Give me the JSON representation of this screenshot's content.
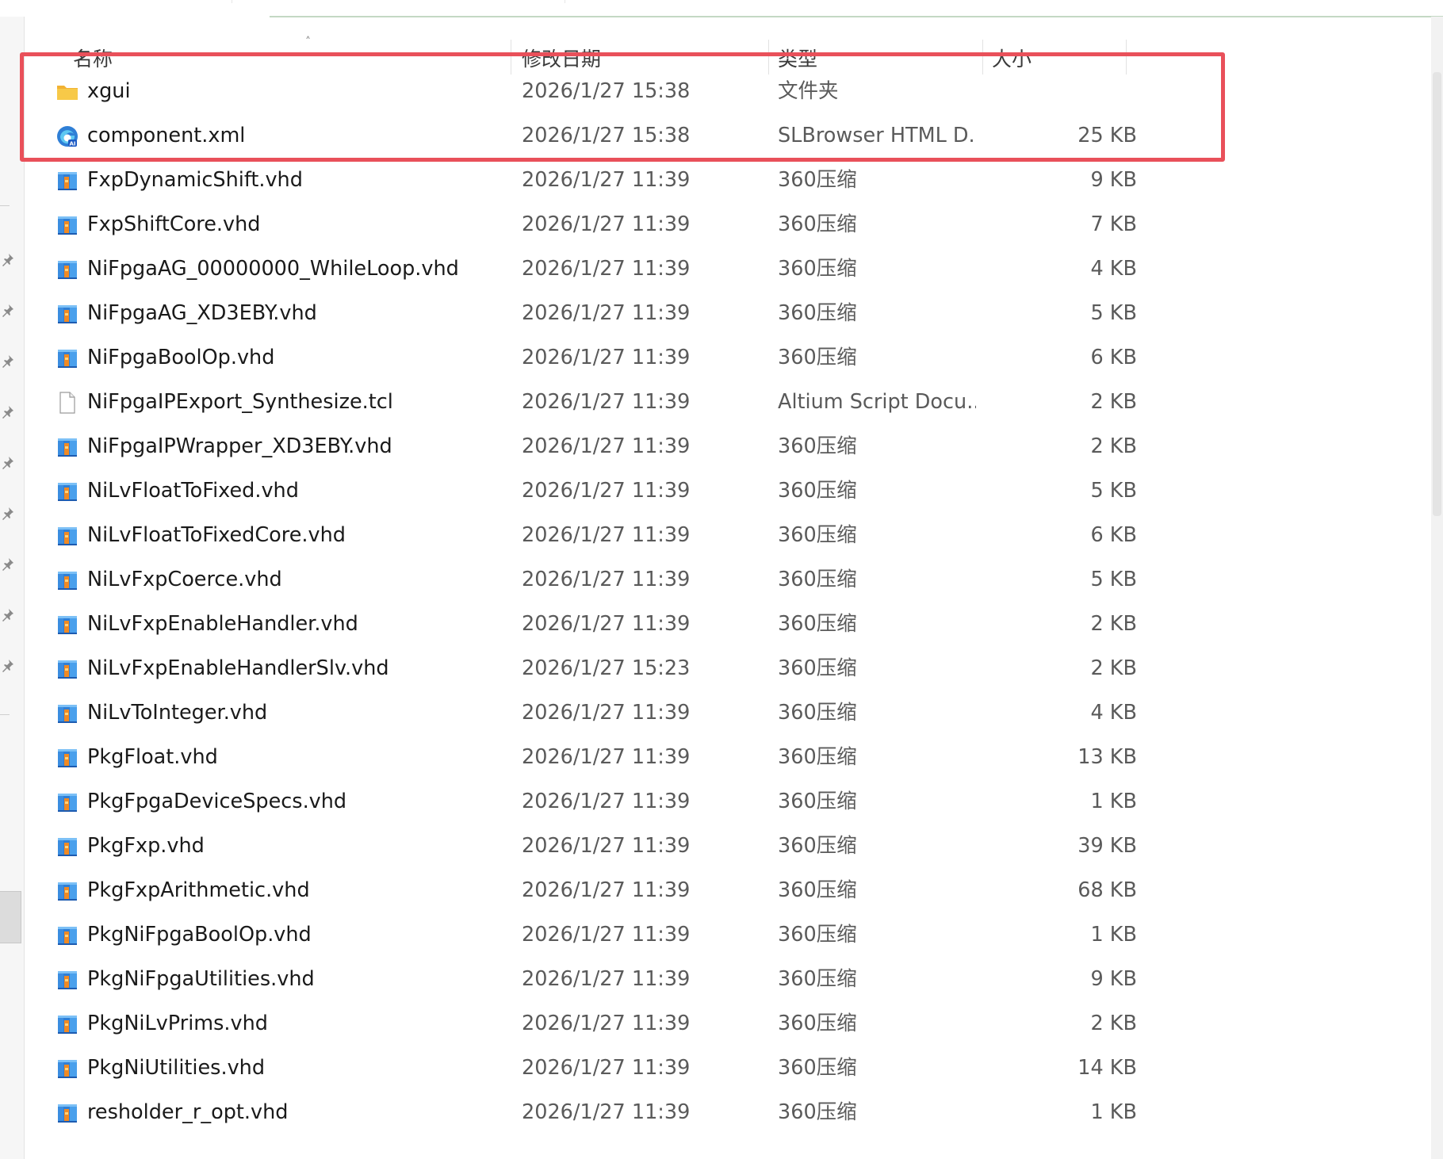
{
  "columns": {
    "name": "名称",
    "modified": "修改日期",
    "type": "类型",
    "size": "大小"
  },
  "files": [
    {
      "name": "xgui",
      "modified": "2026/1/27 15:38",
      "type": "文件夹",
      "size": "",
      "icon": "folder-icon"
    },
    {
      "name": "component.xml",
      "modified": "2026/1/27 15:38",
      "type": "SLBrowser HTML D...",
      "size": "25 KB",
      "icon": "browser-document-icon"
    },
    {
      "name": "FxpDynamicShift.vhd",
      "modified": "2026/1/27 11:39",
      "type": "360压缩",
      "size": "9 KB",
      "icon": "archive-icon"
    },
    {
      "name": "FxpShiftCore.vhd",
      "modified": "2026/1/27 11:39",
      "type": "360压缩",
      "size": "7 KB",
      "icon": "archive-icon"
    },
    {
      "name": "NiFpgaAG_00000000_WhileLoop.vhd",
      "modified": "2026/1/27 11:39",
      "type": "360压缩",
      "size": "4 KB",
      "icon": "archive-icon"
    },
    {
      "name": "NiFpgaAG_XD3EBY.vhd",
      "modified": "2026/1/27 11:39",
      "type": "360压缩",
      "size": "5 KB",
      "icon": "archive-icon"
    },
    {
      "name": "NiFpgaBoolOp.vhd",
      "modified": "2026/1/27 11:39",
      "type": "360压缩",
      "size": "6 KB",
      "icon": "archive-icon"
    },
    {
      "name": "NiFpgaIPExport_Synthesize.tcl",
      "modified": "2026/1/27 11:39",
      "type": "Altium Script Docu...",
      "size": "2 KB",
      "icon": "blank-file-icon"
    },
    {
      "name": "NiFpgaIPWrapper_XD3EBY.vhd",
      "modified": "2026/1/27 11:39",
      "type": "360压缩",
      "size": "2 KB",
      "icon": "archive-icon"
    },
    {
      "name": "NiLvFloatToFixed.vhd",
      "modified": "2026/1/27 11:39",
      "type": "360压缩",
      "size": "5 KB",
      "icon": "archive-icon"
    },
    {
      "name": "NiLvFloatToFixedCore.vhd",
      "modified": "2026/1/27 11:39",
      "type": "360压缩",
      "size": "6 KB",
      "icon": "archive-icon"
    },
    {
      "name": "NiLvFxpCoerce.vhd",
      "modified": "2026/1/27 11:39",
      "type": "360压缩",
      "size": "5 KB",
      "icon": "archive-icon"
    },
    {
      "name": "NiLvFxpEnableHandler.vhd",
      "modified": "2026/1/27 11:39",
      "type": "360压缩",
      "size": "2 KB",
      "icon": "archive-icon"
    },
    {
      "name": "NiLvFxpEnableHandlerSlv.vhd",
      "modified": "2026/1/27 15:23",
      "type": "360压缩",
      "size": "2 KB",
      "icon": "archive-icon"
    },
    {
      "name": "NiLvToInteger.vhd",
      "modified": "2026/1/27 11:39",
      "type": "360压缩",
      "size": "4 KB",
      "icon": "archive-icon"
    },
    {
      "name": "PkgFloat.vhd",
      "modified": "2026/1/27 11:39",
      "type": "360压缩",
      "size": "13 KB",
      "icon": "archive-icon"
    },
    {
      "name": "PkgFpgaDeviceSpecs.vhd",
      "modified": "2026/1/27 11:39",
      "type": "360压缩",
      "size": "1 KB",
      "icon": "archive-icon"
    },
    {
      "name": "PkgFxp.vhd",
      "modified": "2026/1/27 11:39",
      "type": "360压缩",
      "size": "39 KB",
      "icon": "archive-icon"
    },
    {
      "name": "PkgFxpArithmetic.vhd",
      "modified": "2026/1/27 11:39",
      "type": "360压缩",
      "size": "68 KB",
      "icon": "archive-icon"
    },
    {
      "name": "PkgNiFpgaBoolOp.vhd",
      "modified": "2026/1/27 11:39",
      "type": "360压缩",
      "size": "1 KB",
      "icon": "archive-icon"
    },
    {
      "name": "PkgNiFpgaUtilities.vhd",
      "modified": "2026/1/27 11:39",
      "type": "360压缩",
      "size": "9 KB",
      "icon": "archive-icon"
    },
    {
      "name": "PkgNiLvPrims.vhd",
      "modified": "2026/1/27 11:39",
      "type": "360压缩",
      "size": "2 KB",
      "icon": "archive-icon"
    },
    {
      "name": "PkgNiUtilities.vhd",
      "modified": "2026/1/27 11:39",
      "type": "360压缩",
      "size": "14 KB",
      "icon": "archive-icon"
    },
    {
      "name": "resholder_r_opt.vhd",
      "modified": "2026/1/27 11:39",
      "type": "360压缩",
      "size": "1 KB",
      "icon": "archive-icon"
    }
  ],
  "colors": {
    "highlight_border": "#e9505a",
    "folder_yellow": "#f7c948",
    "archive_blue": "#2f7fd6",
    "archive_orange": "#f08a24"
  }
}
